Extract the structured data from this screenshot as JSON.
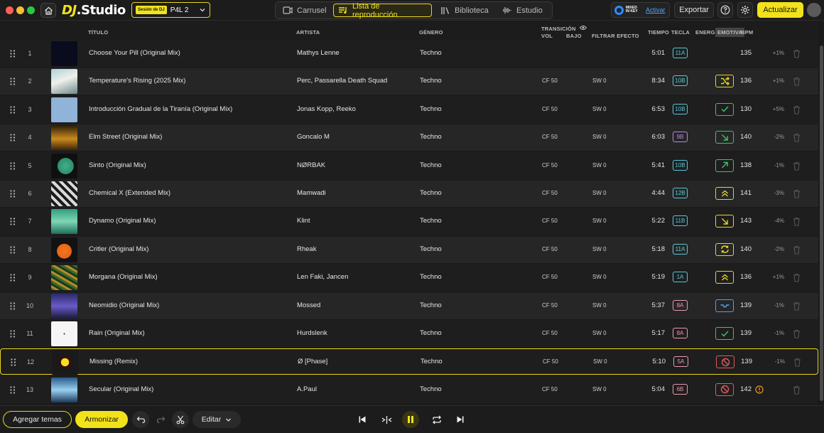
{
  "app": {
    "logo_dj": "DJ",
    "logo_studio": ".Studio"
  },
  "session": {
    "tag": "Sesión de DJ",
    "name": "P4L 2"
  },
  "modes": [
    {
      "label": "Carrusel",
      "icon": "carousel-icon"
    },
    {
      "label": "Lista de reproducción",
      "icon": "playlist-icon",
      "active": true
    },
    {
      "label": "Biblioteca",
      "icon": "library-icon"
    },
    {
      "label": "Estudio",
      "icon": "waveform-icon"
    }
  ],
  "mixedinkey": {
    "brand": "MIXED IN KEY",
    "link": "Activar"
  },
  "header_buttons": {
    "export": "Exportar",
    "update": "Actualizar"
  },
  "columns": {
    "title": "TÍTULO",
    "artist": "ARTISTA",
    "genre": "GÉNERO",
    "transition": "TRANSICIÓN",
    "vol": "VOL",
    "bass": "BAJO",
    "filter_effect": "FILTRAR EFECTO",
    "time": "TIEMPO",
    "key": "TECLA",
    "energy": "ENERGÍA",
    "emotion": "EMOTIVA",
    "bpm": "BPM"
  },
  "colors": {
    "accent": "#f2e21b",
    "key_teal": "#56c8d8",
    "key_purple": "#b38ce0",
    "key_pink": "#e89ab0",
    "energy_yellow": "#e8d51e",
    "energy_green": "#3cc46a",
    "energy_blue": "#4aa3ff",
    "energy_red": "#e05a5a"
  },
  "tracks": [
    {
      "n": "1",
      "title": "Choose Your Pill (Original Mix)",
      "artist": "Mathys Lenne",
      "genre": "Techno",
      "transition": "",
      "filter": "",
      "time": "5:01",
      "key": "11A",
      "key_color": "#56c8d8",
      "energy": "none",
      "energy_color": "",
      "bpm": "135",
      "pct": "+1%",
      "thumb": "thumb-1"
    },
    {
      "n": "2",
      "title": "Temperature's Rising (2025 Mix)",
      "artist": "Perc, Passarella Death Squad",
      "genre": "Techno",
      "transition": "CF 50",
      "filter": "SW 0",
      "time": "8:34",
      "key": "10B",
      "key_color": "#56c8d8",
      "energy": "shuffle-icon",
      "energy_color": "#e8d51e",
      "bpm": "136",
      "pct": "+1%",
      "thumb": "thumb-2"
    },
    {
      "n": "3",
      "title": "Introducción Gradual de la Tiranía (Original Mix)",
      "artist": "Jonas Kopp, Reeko",
      "genre": "Techno",
      "transition": "CF 50",
      "filter": "SW 0",
      "time": "6:53",
      "key": "10B",
      "key_color": "#56c8d8",
      "energy": "check-icon",
      "energy_color": "#3cc46a",
      "bpm": "130",
      "pct": "+5%",
      "thumb": "thumb-3"
    },
    {
      "n": "4",
      "title": "Elm Street (Original Mix)",
      "artist": "Goncalo M",
      "genre": "Techno",
      "transition": "CF 50",
      "filter": "SW 0",
      "time": "6:03",
      "key": "9B",
      "key_color": "#b38ce0",
      "energy": "arrow-down-right-icon",
      "energy_color": "#3cc46a",
      "bpm": "140",
      "pct": "-2%",
      "thumb": "thumb-4"
    },
    {
      "n": "5",
      "title": "Sinto (Original Mix)",
      "artist": "NØRBAK",
      "genre": "Techno",
      "transition": "CF 50",
      "filter": "SW 0",
      "time": "5:41",
      "key": "10B",
      "key_color": "#56c8d8",
      "energy": "arrow-up-right-icon",
      "energy_color": "#3cc46a",
      "bpm": "138",
      "pct": "-1%",
      "thumb": "thumb-5"
    },
    {
      "n": "6",
      "title": "Chemical X (Extended Mix)",
      "artist": "Mamwadi",
      "genre": "Techno",
      "transition": "CF 50",
      "filter": "SW 0",
      "time": "4:44",
      "key": "12B",
      "key_color": "#56c8d8",
      "energy": "double-chevron-up-icon",
      "energy_color": "#e8d51e",
      "bpm": "141",
      "pct": "-3%",
      "thumb": "thumb-6"
    },
    {
      "n": "7",
      "title": "Dynamo (Original Mix)",
      "artist": "Klint",
      "genre": "Techno",
      "transition": "CF 50",
      "filter": "SW 0",
      "time": "5:22",
      "key": "11B",
      "key_color": "#56c8d8",
      "energy": "arrow-down-right-icon",
      "energy_color": "#e8d51e",
      "bpm": "143",
      "pct": "-4%",
      "thumb": "thumb-7"
    },
    {
      "n": "8",
      "title": "Critler (Original Mix)",
      "artist": "Rheak",
      "genre": "Techno",
      "transition": "CF 50",
      "filter": "SW 0",
      "time": "5:18",
      "key": "11A",
      "key_color": "#56c8d8",
      "energy": "refresh-icon",
      "energy_color": "#e8d51e",
      "bpm": "140",
      "pct": "-2%",
      "thumb": "thumb-8"
    },
    {
      "n": "9",
      "title": "Morgana (Original Mix)",
      "artist": "Len Faki, Jancen",
      "genre": "Techno",
      "transition": "CF 50",
      "filter": "SW 0",
      "time": "5:19",
      "key": "1A",
      "key_color": "#56c8d8",
      "energy": "double-chevron-up-icon",
      "energy_color": "#e8d51e",
      "bpm": "136",
      "pct": "+1%",
      "thumb": "thumb-9"
    },
    {
      "n": "10",
      "title": "Neomidio (Original Mix)",
      "artist": "Mossed",
      "genre": "Techno",
      "transition": "CF 50",
      "filter": "SW 0",
      "time": "5:37",
      "key": "8A",
      "key_color": "#e89ab0",
      "energy": "step-icon",
      "energy_color": "#4aa3ff",
      "bpm": "139",
      "pct": "-1%",
      "thumb": "thumb-10"
    },
    {
      "n": "11",
      "title": "Rain (Original Mix)",
      "artist": "Hurdslenk",
      "genre": "Techno",
      "transition": "CF 50",
      "filter": "SW 0",
      "time": "5:17",
      "key": "8A",
      "key_color": "#e89ab0",
      "energy": "check-icon",
      "energy_color": "#3cc46a",
      "bpm": "139",
      "pct": "-1%",
      "thumb": "thumb-11"
    },
    {
      "n": "12",
      "title": "Missing (Remix)",
      "artist": "Ø [Phase]",
      "genre": "Techno",
      "transition": "CF 50",
      "filter": "SW 0",
      "time": "5:10",
      "key": "5A",
      "key_color": "#e89ab0",
      "energy": "blocked-icon",
      "energy_color": "#e05a5a",
      "bpm": "139",
      "pct": "-1%",
      "thumb": "thumb-12",
      "selected": true
    },
    {
      "n": "13",
      "title": "Secular (Original Mix)",
      "artist": "A.Paul",
      "genre": "Techno",
      "transition": "CF 50",
      "filter": "SW 0",
      "time": "5:04",
      "key": "6B",
      "key_color": "#e89ab0",
      "energy": "blocked-icon",
      "energy_color": "#e05a5a",
      "bpm": "142",
      "pct": "",
      "thumb": "thumb-13",
      "warning": true
    }
  ],
  "bottom": {
    "add": "Agregar temas",
    "harmonize": "Armonizar",
    "edit": "Editar"
  }
}
